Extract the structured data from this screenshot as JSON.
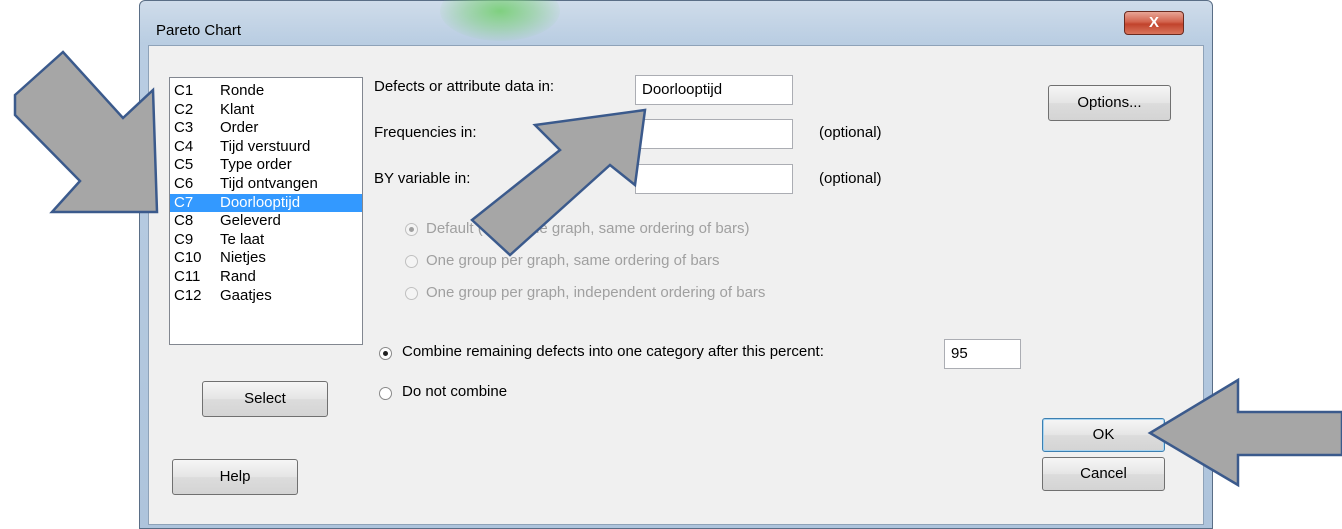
{
  "dialog": {
    "title": "Pareto Chart",
    "close_glyph": "X"
  },
  "variables": [
    {
      "col": "C1",
      "name": "Ronde"
    },
    {
      "col": "C2",
      "name": "Klant"
    },
    {
      "col": "C3",
      "name": "Order"
    },
    {
      "col": "C4",
      "name": "Tijd verstuurd"
    },
    {
      "col": "C5",
      "name": "Type order"
    },
    {
      "col": "C6",
      "name": "Tijd ontvangen"
    },
    {
      "col": "C7",
      "name": "Doorlooptijd",
      "selected": true
    },
    {
      "col": "C8",
      "name": "Geleverd"
    },
    {
      "col": "C9",
      "name": "Te laat"
    },
    {
      "col": "C10",
      "name": "Nietjes"
    },
    {
      "col": "C11",
      "name": "Rand"
    },
    {
      "col": "C12",
      "name": "Gaatjes"
    }
  ],
  "fields": {
    "defects_label": "Defects or attribute data in:",
    "defects_value": "Doorlooptijd",
    "frequencies_label": "Frequencies in:",
    "frequencies_value": "",
    "frequencies_hint": "(optional)",
    "by_label": "BY variable in:",
    "by_value": "",
    "by_hint": "(optional)"
  },
  "by_options": [
    {
      "label": "Default (all on one graph, same ordering of bars)",
      "checked": true,
      "enabled": false
    },
    {
      "label": "One group per graph, same ordering of bars",
      "checked": false,
      "enabled": false
    },
    {
      "label": "One group per graph, independent ordering of bars",
      "checked": false,
      "enabled": false
    }
  ],
  "combine": {
    "combine_label": "Combine remaining defects into one category after this percent:",
    "percent_value": "95",
    "no_combine_label": "Do not combine",
    "selected": "combine"
  },
  "buttons": {
    "options": "Options...",
    "select": "Select",
    "help": "Help",
    "ok": "OK",
    "cancel": "Cancel"
  },
  "annotation_colors": {
    "arrow_fill": "#a6a6a6",
    "arrow_stroke": "#3b5a8c"
  }
}
